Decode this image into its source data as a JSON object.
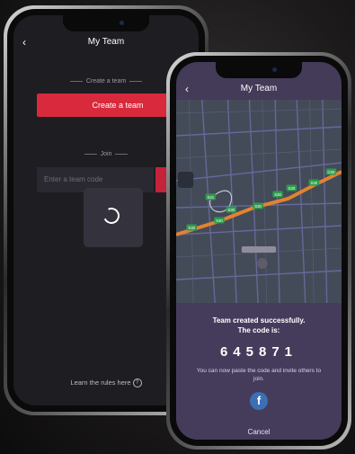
{
  "screen1": {
    "title": "My Team",
    "create_section_label": "Create a team",
    "create_button": "Create a team",
    "join_section_label": "Join",
    "code_placeholder": "Enter a team code",
    "rules_link": "Learn the rules here"
  },
  "screen2": {
    "title": "My Team",
    "success_line1": "Team created successfully.",
    "success_line2": "The code is:",
    "code": "645871",
    "instruction": "You can now paste the code and invite others to join.",
    "cancel": "Cancel",
    "map_labels": [
      "S30",
      "S30",
      "S30",
      "S30",
      "S30",
      "S30",
      "S30",
      "G25",
      "S21"
    ]
  },
  "colors": {
    "accent_red": "#d8293d",
    "sheet_purple": "#453c5c",
    "route_orange": "#e2832f",
    "facebook_blue": "#3b6fb6"
  }
}
